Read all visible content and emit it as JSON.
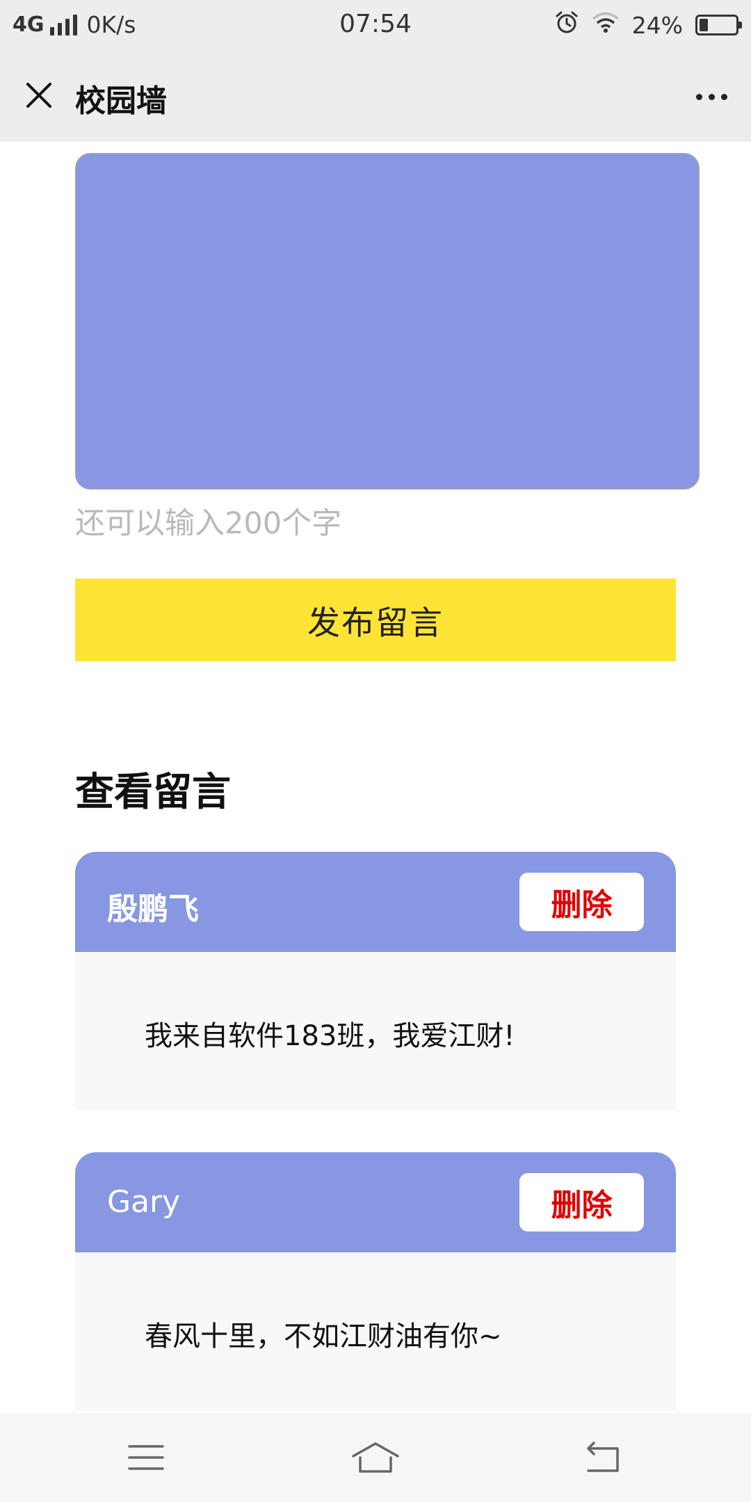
{
  "status_bar": {
    "network": "4G",
    "speed": "0K/s",
    "time": "07:54",
    "battery": "24%",
    "battery_level": 0.24,
    "icons": [
      "signal-icon",
      "alarm-icon",
      "wifi-icon",
      "battery-icon"
    ]
  },
  "nav": {
    "title": "校园墙",
    "close_icon": "close-icon",
    "more_icon": "more-icon"
  },
  "composer": {
    "value": "",
    "counter_prefix": "还可以输入",
    "counter_value": "200",
    "counter_suffix": "个字",
    "publish_label": "发布留言"
  },
  "messages_section": {
    "title": "查看留言",
    "items": [
      {
        "author": "殷鹏飞",
        "delete_label": "删除",
        "content": "我来自软件183班，我爱江财!"
      },
      {
        "author": "Gary",
        "delete_label": "删除",
        "content": "春风十里，不如江财油有你~"
      }
    ]
  },
  "system_nav": {
    "icons": [
      "menu-icon",
      "home-icon",
      "back-icon"
    ]
  },
  "colors": {
    "accent": "#8797e2",
    "publish": "#ffe335",
    "delete_text": "#e00000",
    "counter_text": "#b9b9b9"
  }
}
